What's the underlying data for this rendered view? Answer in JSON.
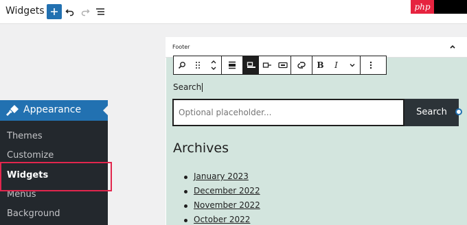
{
  "header": {
    "title": "Widgets",
    "add_icon": "plus-icon",
    "undo_icon": "undo-icon",
    "redo_icon": "redo-icon",
    "list_view_icon": "list-view-icon",
    "brand_logo": "php"
  },
  "sidebar": {
    "menu_label": "Appearance",
    "menu_icon": "paintbrush-icon",
    "items": [
      {
        "label": "Themes"
      },
      {
        "label": "Customize"
      },
      {
        "label": "Widgets",
        "active": true
      },
      {
        "label": "Menus"
      },
      {
        "label": "Background"
      }
    ]
  },
  "widget_area": {
    "title": "Footer",
    "collapse_icon": "chevron-up-icon"
  },
  "block_toolbar": {
    "tools": [
      "search-icon",
      "drag-handle-icon",
      "move-up-down-icon",
      "align-icon",
      "button-outside-icon",
      "button-only-icon",
      "button-inside-icon",
      "link-icon",
      "bold",
      "italic",
      "chevron-down-icon",
      "more-options-icon"
    ],
    "bold_label": "B",
    "italic_label": "I"
  },
  "search_block": {
    "label": "Search",
    "placeholder": "Optional placeholder...",
    "button_label": "Search"
  },
  "archives": {
    "title": "Archives",
    "items": [
      "January 2023",
      "December 2022",
      "November 2022",
      "October 2022"
    ]
  },
  "colors": {
    "accent": "#2271b1",
    "sidebar_bg": "#23282d",
    "highlight": "#e2264d",
    "block_bg": "#d3e5de",
    "button_bg": "#2c3338",
    "logo_red": "#e6233f"
  }
}
